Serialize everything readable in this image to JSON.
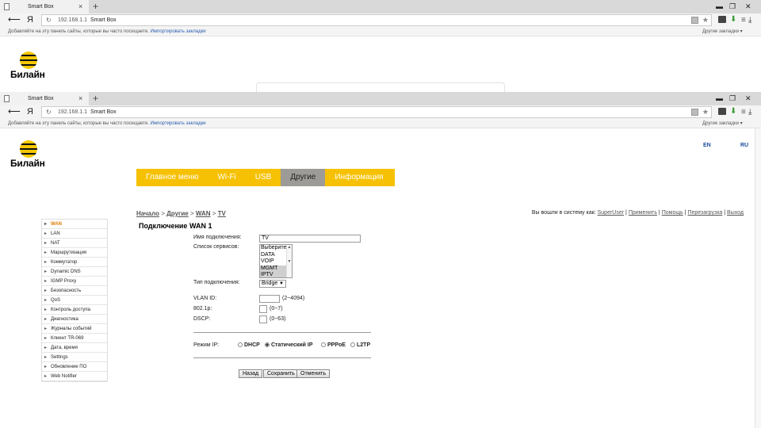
{
  "browser": {
    "tab_title": "Smart Box",
    "address": "192.168.1.1",
    "page_title": "Smart Box",
    "yandex": "Я",
    "bookmarks_prompt": "Добавляйте на эту панель сайты, которые вы часто посещаете.",
    "import_bookmarks": "Импортировать закладки",
    "other_bookmarks": "Другие закладки"
  },
  "brand": "Билайн",
  "lang": {
    "en": "EN",
    "ru": "RU"
  },
  "menu": [
    {
      "label": "Главное меню",
      "active": false
    },
    {
      "label": "Wi-Fi",
      "active": false
    },
    {
      "label": "USB",
      "active": false
    },
    {
      "label": "Другие",
      "active": true
    },
    {
      "label": "Информация",
      "active": false
    }
  ],
  "breadcrumb": {
    "home": "Начало",
    "other": "Другие",
    "wan": "WAN",
    "tv": "TV",
    "sep": " > "
  },
  "login": {
    "prefix": "Вы вошли в систему как:",
    "user": "SuperUser",
    "apply": "Применить",
    "help": "Помощь",
    "reboot": "Перезагрузка",
    "logout": "Выход"
  },
  "page_title": "Подключение WAN 1",
  "sidebar": [
    "WAN",
    "LAN",
    "NAT",
    "Маршрутизация",
    "Коммутатор",
    "Dynamic DNS",
    "IGMP Proxy",
    "Безопасность",
    "QoS",
    "Контроль доступа",
    "Диагностика",
    "Журналы событий",
    "Клиент TR-069",
    "Дата, время",
    "Settings",
    "Обновление ПО",
    "Web Notifier"
  ],
  "form": {
    "name_label": "Имя подключения:",
    "name_value": "TV",
    "services_label": "Список сервисов:",
    "services": [
      "Выберите",
      "DATA",
      "VOIP",
      "MGMT",
      "IPTV"
    ],
    "services_selected": [
      "MGMT",
      "IPTV"
    ],
    "type_label": "Тип подключения:",
    "type_value": "Bridge",
    "vlan_label": "VLAN ID:",
    "vlan_hint": "(2~4094)",
    "p8021_label": "802.1p:",
    "p8021_hint": "(0~7)",
    "dscp_label": "DSCP:",
    "dscp_hint": "(0~63)",
    "ip_mode_label": "Режим IP:",
    "ip_modes": [
      "DHCP",
      "Статический IP",
      "PPPoE",
      "L2TP"
    ],
    "ip_mode_selected": "Статический IP"
  },
  "buttons": {
    "back": "Назад",
    "save": "Сохранить",
    "cancel": "Отменить"
  }
}
